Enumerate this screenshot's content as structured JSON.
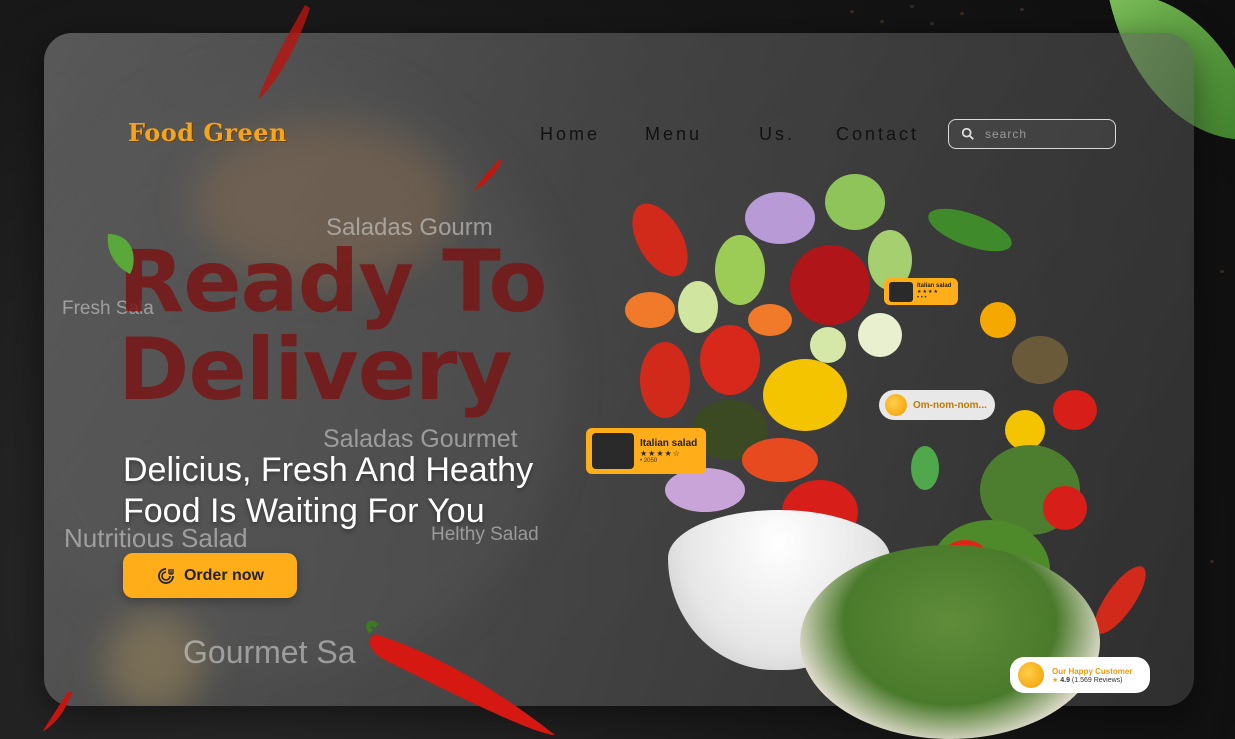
{
  "brand": {
    "logo_text": "Food Green"
  },
  "nav": {
    "links": [
      {
        "label": "Home"
      },
      {
        "label": "Menu"
      },
      {
        "label": "Us."
      },
      {
        "label": "Contact"
      }
    ]
  },
  "search": {
    "placeholder": "search",
    "icon": "search-icon"
  },
  "ghost_labels": {
    "saladas_gourmet_top": "Saladas Gourm",
    "fresh_salad": "Fresh Sala",
    "saladas_gourmet_mid": "Saladas Gourmet",
    "nutritious_salad": "Nutritious Salad",
    "helthy_salad": "Helthy Salad",
    "gourmet_salad": "Gourmet Sa"
  },
  "hero": {
    "title_line1": "Ready To",
    "title_line2": "Delivery",
    "subtitle_line1": "Delicius, Fresh And Heathy",
    "subtitle_line2": "Food Is Waiting For You",
    "order_button": "Order now",
    "order_icon": "food-delivery-icon"
  },
  "cards": {
    "italian_large": {
      "title": "Italian salad",
      "stars": "★★★★☆",
      "meta": "• 2050"
    },
    "italian_small": {
      "title": "Italian salad",
      "stars": "★★★★",
      "meta": "• • •"
    },
    "omnom": {
      "text": "Om-nom-nom..."
    },
    "customer": {
      "title": "Our Happy Customer",
      "rating": "4.9",
      "reviews": "(1.569 Reviews)"
    }
  },
  "colors": {
    "accent": "#ffae1a",
    "title_red": "#7a1414",
    "logo": "#f3a51b"
  }
}
